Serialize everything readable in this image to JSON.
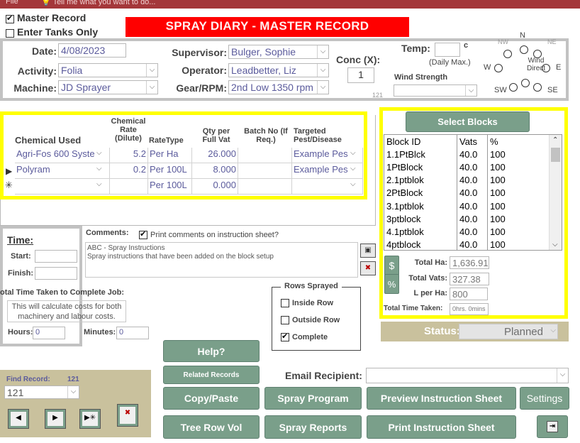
{
  "ribbon": {
    "file": "File",
    "tell_me": "Tell me what you want to do..."
  },
  "header": {
    "master_record_label": "Master Record",
    "enter_tanks_label": "Enter Tanks Only",
    "title": "SPRAY DIARY - MASTER RECORD"
  },
  "form": {
    "date_label": "Date:",
    "date_value": "4/08/2023",
    "activity_label": "Activity:",
    "activity_value": "Folia",
    "machine_label": "Machine:",
    "machine_value": "JD Sprayer",
    "supervisor_label": "Supervisor:",
    "supervisor_value": "Bulger, Sophie",
    "operator_label": "Operator:",
    "operator_value": "Leadbetter, Liz",
    "gear_label": "Gear/RPM:",
    "gear_value": "2nd Low 1350 rpm",
    "conc_label": "Conc (X):",
    "conc_value": "1",
    "temp_label": "Temp:",
    "temp_unit": "c",
    "temp_note": "(Daily Max.)",
    "wind_strength_label": "Wind Strength",
    "wind_strength_num": "121",
    "wind_dir_label": "Wind Direct",
    "compass": {
      "n": "N",
      "ne": "NE",
      "nw": "NW",
      "w": "W",
      "e": "E",
      "sw": "SW",
      "se": "SE"
    }
  },
  "chemicals": {
    "headers": {
      "chemical_used": "Chemical Used",
      "rate": "Chemical Rate (Dilute)",
      "rate_type": "RateType",
      "qty": "Qty per Full Vat",
      "batch": "Batch No (If Req.)",
      "target": "Targeted Pest/Disease"
    },
    "rows": [
      {
        "chemical": "Agri-Fos 600 Syste",
        "rate": "5.2",
        "rate_type": "Per Ha",
        "qty": "26.000",
        "batch": "",
        "target": "Example Pes"
      },
      {
        "chemical": "Polyram",
        "rate": "0.2",
        "rate_type": "Per 100L",
        "qty": "8.000",
        "batch": "",
        "target": "Example Pes"
      },
      {
        "chemical": "",
        "rate": "",
        "rate_type": "Per 100L",
        "qty": "0.000",
        "batch": "",
        "target": ""
      }
    ]
  },
  "blocks": {
    "select_label": "Select Blocks",
    "headers": {
      "id": "Block ID",
      "vats": "Vats",
      "pct": "%"
    },
    "rows": [
      {
        "id": "1.1PtBlck",
        "vats": "40.0",
        "pct": "100"
      },
      {
        "id": "1PtBlock",
        "vats": "40.0",
        "pct": "100"
      },
      {
        "id": "2.1ptblok",
        "vats": "40.0",
        "pct": "100"
      },
      {
        "id": "2PtBlock",
        "vats": "40.0",
        "pct": "100"
      },
      {
        "id": "3.1ptblok",
        "vats": "40.0",
        "pct": "100"
      },
      {
        "id": "3ptblock",
        "vats": "40.0",
        "pct": "100"
      },
      {
        "id": "4.1ptblok",
        "vats": "40.0",
        "pct": "100"
      },
      {
        "id": "4ptblock",
        "vats": "40.0",
        "pct": "100"
      }
    ],
    "total_ha_label": "Total Ha:",
    "total_ha_value": "1,636.91",
    "total_vats_label": "Total Vats:",
    "total_vats_value": "327.38",
    "l_per_ha_label": "L per Ha:",
    "l_per_ha_value": "800",
    "total_time_label": "Total Time Taken:",
    "total_time_value": "0hrs. 0mins",
    "dollar_btn": "$",
    "pct_btn": "%",
    "status_label": "Status:",
    "status_value": "Planned"
  },
  "time": {
    "title": "Time:",
    "start_label": "Start:",
    "finish_label": "Finish:",
    "total_label": "otal Time Taken to Complete Job:",
    "note": "This will calculate costs for both machinery and labour costs.",
    "hours_label": "Hours:",
    "hours_value": "0",
    "minutes_label": "Minutes:",
    "minutes_value": "0"
  },
  "comments": {
    "label": "Comments:",
    "print_label": "Print comments on instruction sheet?",
    "line1": "ABC - Spray Instructions",
    "line2": "Spray instructions that have been added on the block setup"
  },
  "rows_sprayed": {
    "title": "Rows Sprayed",
    "inside": "Inside Row",
    "outside": "Outside Row",
    "complete": "Complete"
  },
  "find": {
    "label": "Find Record:",
    "num": "121",
    "value": "121"
  },
  "buttons": {
    "help": "Help?",
    "related": "Related Records",
    "copy": "Copy/Paste",
    "tree": "Tree Row Vol",
    "program": "Spray Program",
    "reports": "Spray Reports",
    "preview": "Preview Instruction Sheet",
    "print": "Print Instruction Sheet",
    "settings": "Settings"
  },
  "email": {
    "label": "Email Recipient:",
    "value": ""
  },
  "colors": {
    "accent": "#7a9f8a",
    "banner": "#ff0000",
    "highlight": "#ffff00",
    "ribbon": "#a4373a"
  }
}
